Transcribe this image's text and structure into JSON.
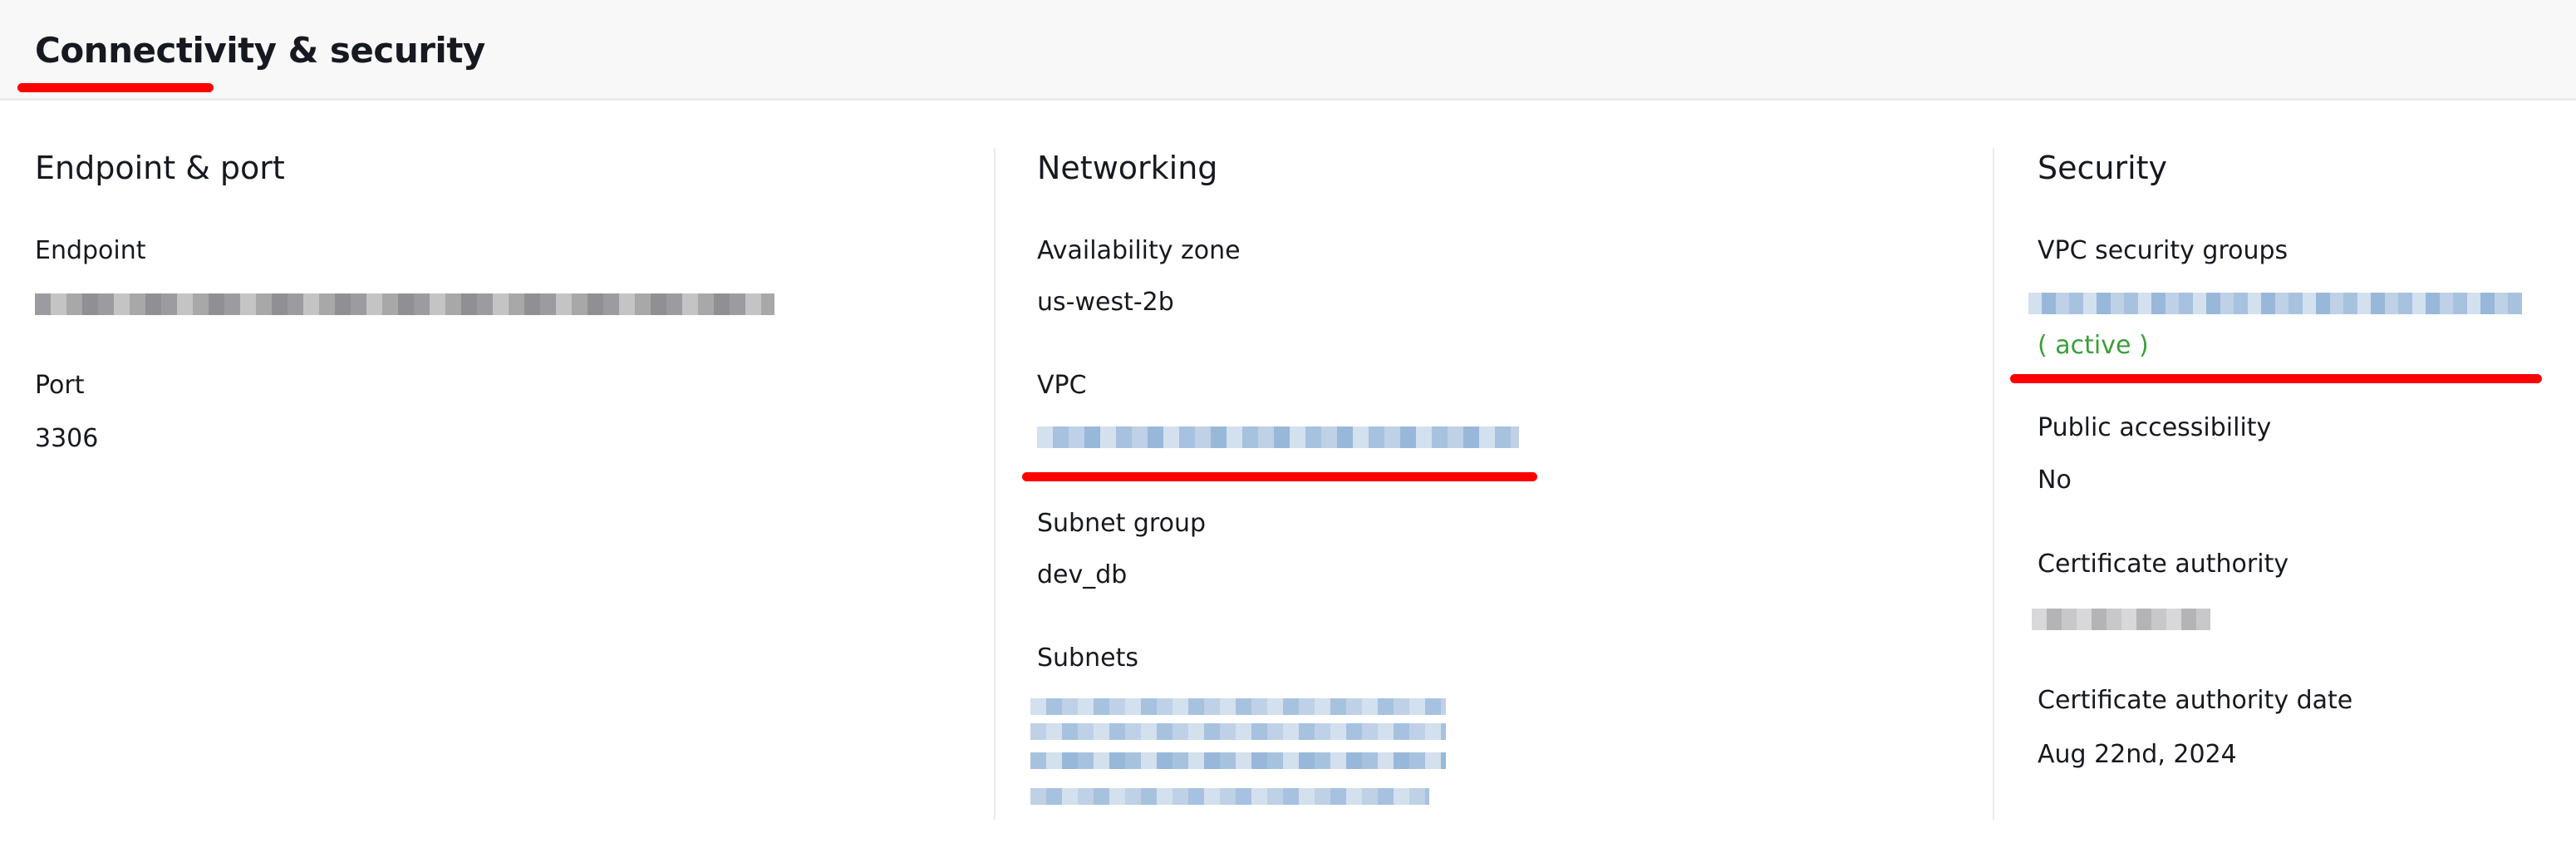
{
  "header": {
    "title": "Connectivity & security"
  },
  "columns": {
    "endpoint": {
      "heading": "Endpoint & port",
      "endpoint_label": "Endpoint",
      "port_label": "Port",
      "port_value": "3306"
    },
    "networking": {
      "heading": "Networking",
      "az_label": "Availability zone",
      "az_value": "us-west-2b",
      "vpc_label": "VPC",
      "subnet_group_label": "Subnet group",
      "subnet_group_value": "dev_db",
      "subnets_label": "Subnets"
    },
    "security": {
      "heading": "Security",
      "sg_label": "VPC security groups",
      "sg_status": "( active )",
      "public_label": "Public accessibility",
      "public_value": "No",
      "ca_label": "Certificate authority",
      "ca_date_label": "Certificate authority date",
      "ca_date_value": "Aug 22nd, 2024"
    }
  },
  "colors": {
    "annotation": "#ff0000",
    "status_active": "#3a9e3a",
    "link_redacted": "#a7c2de",
    "text_redacted": "#a5a5a8"
  }
}
